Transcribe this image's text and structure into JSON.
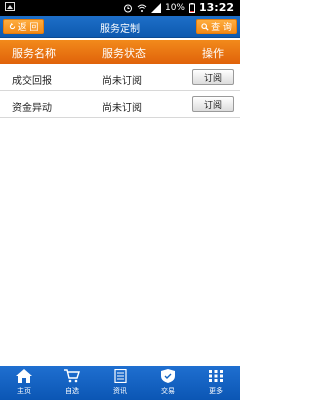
{
  "status_bar": {
    "battery_text": "10%",
    "time": "13:22"
  },
  "header": {
    "title": "服务定制",
    "back_label": "返 回",
    "query_label": "查 询"
  },
  "table": {
    "columns": [
      "服务名称",
      "服务状态",
      "操作"
    ],
    "rows": [
      {
        "name": "成交回报",
        "status": "尚未订阅",
        "action": "订阅"
      },
      {
        "name": "资金异动",
        "status": "尚未订阅",
        "action": "订阅"
      }
    ]
  },
  "bottom_nav": {
    "items": [
      {
        "label": "主页",
        "icon": "home-icon"
      },
      {
        "label": "自选",
        "icon": "cart-icon"
      },
      {
        "label": "资讯",
        "icon": "news-icon"
      },
      {
        "label": "交易",
        "icon": "shield-icon"
      },
      {
        "label": "更多",
        "icon": "grid-icon"
      }
    ]
  },
  "colors": {
    "title_bar": "#1565c0",
    "accent_orange": "#f28a17",
    "header_orange": "#e0620a"
  }
}
